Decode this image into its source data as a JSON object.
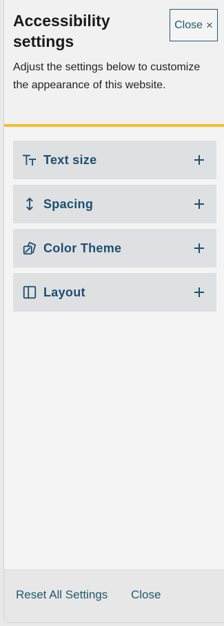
{
  "header": {
    "title": "Accessibility settings",
    "close_label": "Close",
    "close_icon": "close-icon",
    "description": "Adjust the settings below to customize the appearance of this website."
  },
  "sections": [
    {
      "label": "Text size",
      "icon": "text-size-icon",
      "expand_icon": "plus-icon"
    },
    {
      "label": "Spacing",
      "icon": "vertical-arrows-icon",
      "expand_icon": "plus-icon"
    },
    {
      "label": "Color Theme",
      "icon": "color-theme-icon",
      "expand_icon": "plus-icon"
    },
    {
      "label": "Layout",
      "icon": "layout-icon",
      "expand_icon": "plus-icon"
    }
  ],
  "footer": {
    "reset_label": "Reset All Settings",
    "close_label": "Close"
  },
  "colors": {
    "accent": "#1d5a6f",
    "section_label": "#1d4f71",
    "highlight_rule": "#f5be2d",
    "section_background": "#dfe0e2"
  }
}
